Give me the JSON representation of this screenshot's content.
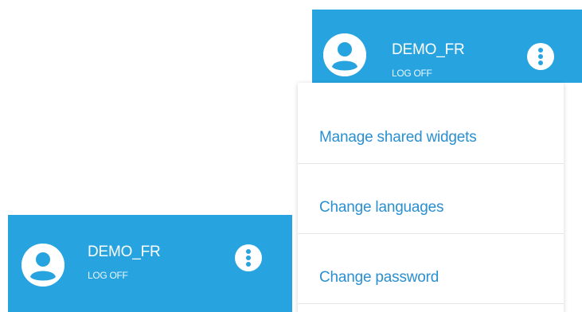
{
  "user_bar": {
    "username": "DEMO_FR",
    "logoff_label": "LOG OFF",
    "avatar_icon": "user-circle-icon",
    "menu_icon": "more-vertical-icon",
    "background_color": "#27a4e0"
  },
  "user_bar_secondary": {
    "username": "DEMO_FR",
    "logoff_label": "LOG OFF",
    "avatar_icon": "user-circle-icon",
    "menu_icon": "more-vertical-icon"
  },
  "user_menu": {
    "items": [
      {
        "label": "Manage shared widgets"
      },
      {
        "label": "Change languages"
      },
      {
        "label": "Change password"
      }
    ],
    "text_color": "#2a8fd0"
  }
}
